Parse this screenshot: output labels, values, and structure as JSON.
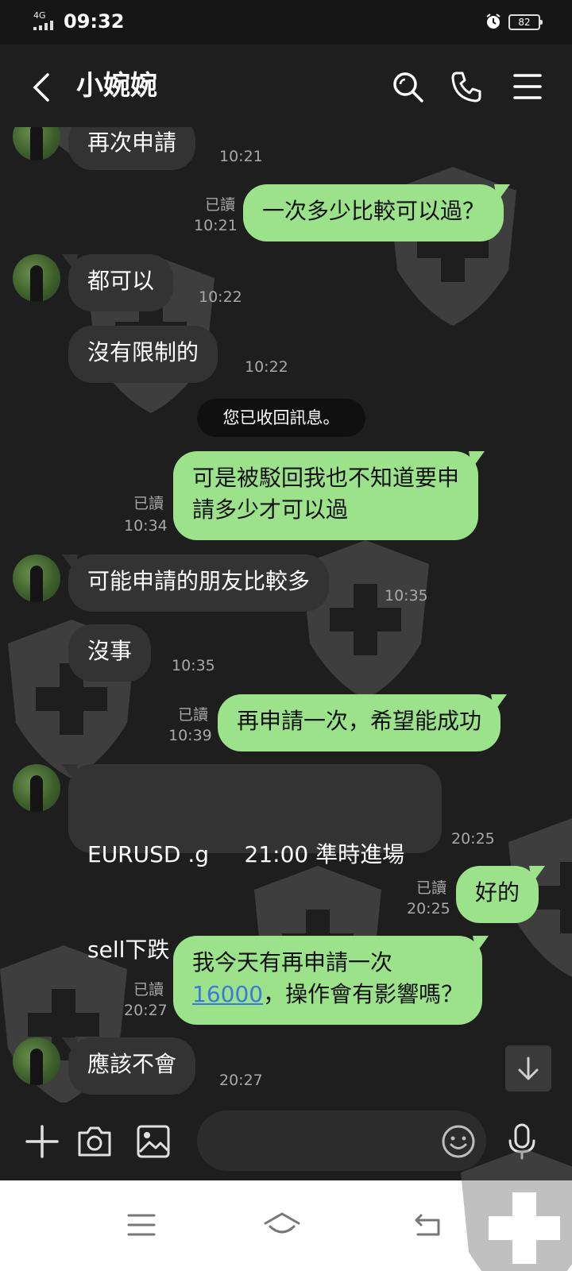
{
  "status_bar": {
    "network": "4G",
    "time": "09:32",
    "battery": "82"
  },
  "header": {
    "title": "小婉婉"
  },
  "messages": [
    {
      "text": "再次申請",
      "time": "10:21"
    },
    {
      "text": "一次多少比較可以過？",
      "read": "已讀",
      "time": "10:21"
    },
    {
      "text": "都可以",
      "time": "10:22"
    },
    {
      "text": "沒有限制的",
      "time": "10:22"
    },
    {
      "text": "您已收回訊息。"
    },
    {
      "line1": "可是被駁回我也不知道要申",
      "line2": "請多少才可以過",
      "read": "已讀",
      "time": "10:34"
    },
    {
      "text": "可能申請的朋友比較多",
      "time": "10:35"
    },
    {
      "text": "沒事",
      "time": "10:35"
    },
    {
      "text": "再申請一次，希望能成功",
      "read": "已讀",
      "time": "10:39"
    },
    {
      "line1": "EURUSD .g     21:00 準時進場",
      "line2": "sell下跌",
      "time": "20:25"
    },
    {
      "text": "好的",
      "read": "已讀",
      "time": "20:25"
    },
    {
      "line1": "我今天有再申請一次",
      "link": "16000",
      "line2_rest": "，操作會有影響嗎？",
      "read": "已讀",
      "time": "20:27"
    },
    {
      "text": "應該不會",
      "time": "20:27"
    }
  ],
  "input": {
    "placeholder": ""
  },
  "colors": {
    "outgoing_bubble": "#9be28a",
    "incoming_bubble": "#333333",
    "background": "#1e1e1e",
    "link": "#3a7bd5"
  }
}
